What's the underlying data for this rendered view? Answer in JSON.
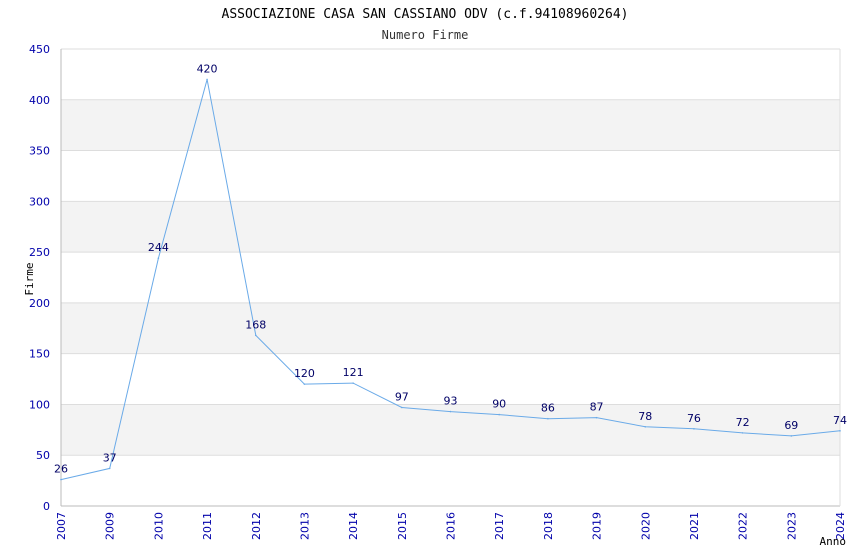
{
  "chart_data": {
    "type": "line",
    "title": "ASSOCIAZIONE CASA SAN CASSIANO ODV (c.f.94108960264)",
    "subtitle": "Numero Firme",
    "xlabel": "Anno",
    "ylabel": "Firme",
    "categories": [
      "2007",
      "2009",
      "2010",
      "2011",
      "2012",
      "2013",
      "2014",
      "2015",
      "2016",
      "2017",
      "2018",
      "2019",
      "2020",
      "2021",
      "2022",
      "2023",
      "2024"
    ],
    "values": [
      26,
      37,
      244,
      420,
      168,
      120,
      121,
      97,
      93,
      90,
      86,
      87,
      78,
      76,
      72,
      69,
      74
    ],
    "ylim": [
      0,
      450
    ],
    "yticks": [
      0,
      50,
      100,
      150,
      200,
      250,
      300,
      350,
      400,
      450
    ],
    "grid": true,
    "banded_background": true,
    "colors": {
      "line": "#6aaae8",
      "tick_labels": "#0000aa",
      "data_labels": "#000066",
      "band": "#f3f3f3",
      "grid": "#dddddd",
      "axis": "#bbbbbb"
    }
  }
}
